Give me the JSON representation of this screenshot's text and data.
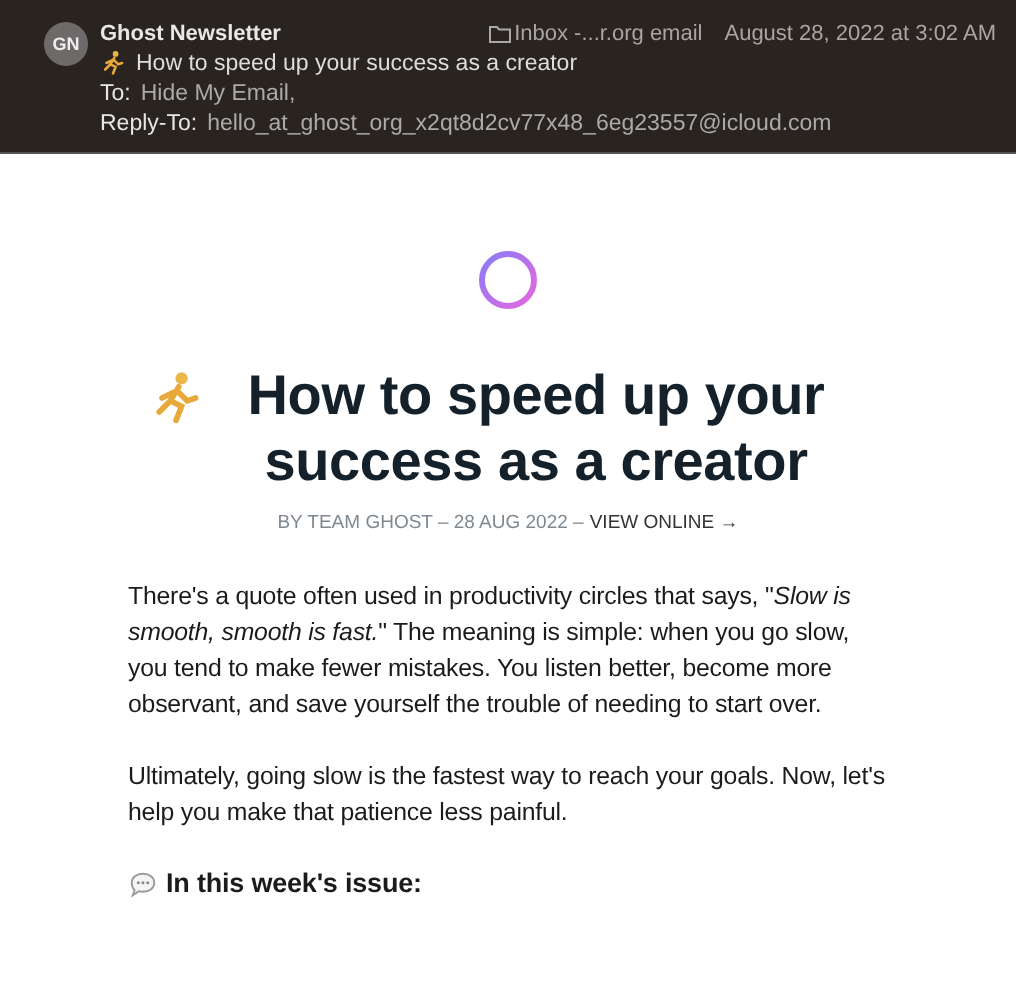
{
  "header": {
    "avatar": "GN",
    "sender": "Ghost Newsletter",
    "mailbox": "Inbox -...r.org email",
    "date": "August 28, 2022 at 3:02 AM",
    "subject": "How to speed up your success as a creator",
    "to_label": "To:",
    "to": "Hide My Email,",
    "reply_to_label": "Reply-To:",
    "reply_to": "hello_at_ghost_org_x2qt8d2cv77x48_6eg23557@icloud.com"
  },
  "article": {
    "title": "How to speed up your success as a creator",
    "byline": "BY TEAM GHOST – 28 AUG 2022 –",
    "view_online": "VIEW ONLINE →",
    "paragraphs": [
      "There's a quote often used in productivity circles that says, \"*Slow is smooth, smooth is fast.*\" The meaning is simple: when you go slow, you tend to make fewer mistakes. You listen better, become more observant, and save yourself the trouble of needing to start over.",
      "Ultimately, going slow is the fastest way to reach your goals. Now, let's help you make that patience less painful."
    ],
    "section_heading": "In this week's issue:"
  }
}
